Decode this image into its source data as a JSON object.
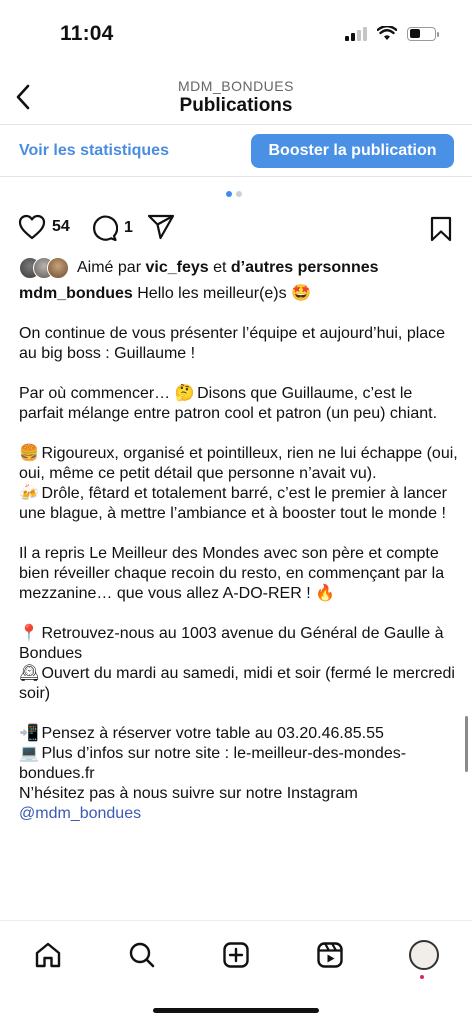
{
  "status_bar": {
    "time": "11:04"
  },
  "header": {
    "account": "MDM_BONDUES",
    "title": "Publications"
  },
  "stats": {
    "link_label": "Voir les statistiques",
    "boost_label": "Booster la publication"
  },
  "actions": {
    "likes": "54",
    "comments": "1"
  },
  "liked_by": {
    "prefix": "Aimé par",
    "user": "vic_feys",
    "connector": "et",
    "others": "d’autres personnes"
  },
  "caption": {
    "username": "mdm_bondues",
    "intro": "Hello les meilleur(e)s",
    "intro_emoji": "🤩",
    "p1": "On continue de vous présenter l’équipe et aujourd’hui, place au big boss : Guillaume !",
    "p2_start": "Par où commencer…",
    "p2_emoji": "🤔",
    "p2_end": "Disons que Guillaume, c’est le parfait mélange entre patron cool et patron (un peu) chiant.",
    "p3a_emoji": "🍔",
    "p3a": "Rigoureux, organisé et pointilleux, rien ne lui échappe (oui, oui, même ce petit détail que personne n’avait vu).",
    "p3b_emoji": "🍻",
    "p3b": "Drôle, fêtard et totalement barré, c’est le premier à lancer une blague, à mettre l’ambiance et à booster tout le monde !",
    "p4": "Il a repris Le Meilleur des Mondes avec son père et compte bien réveiller chaque recoin du resto, en commençant par la mezzanine… que vous allez A-DO-RER !",
    "p4_emoji": "🔥",
    "p5a_emoji": "📍",
    "p5a": "Retrouvez-nous au 1003 avenue du Général de Gaulle à Bondues",
    "p5b_emoji": "🕰",
    "p5b": "Ouvert du mardi au samedi, midi et soir (fermé le mercredi soir)",
    "p6a_emoji": "📲",
    "p6a": "Pensez à réserver votre table au 03.20.46.85.55",
    "p6b_emoji": "💻",
    "p6b": "Plus d’infos sur notre site : le-meilleur-des-mondes-bondues.fr",
    "p6c": "N’hésitez pas à nous suivre sur notre Instagram",
    "mention": "@mdm_bondues"
  },
  "colors": {
    "accent": "#4a91e6",
    "link": "#4a8de0",
    "mention": "#3b5bb5"
  },
  "icons": [
    "back-chevron-icon",
    "heart-icon",
    "comment-icon",
    "share-icon",
    "bookmark-icon",
    "home-icon",
    "search-icon",
    "create-icon",
    "reels-icon"
  ]
}
